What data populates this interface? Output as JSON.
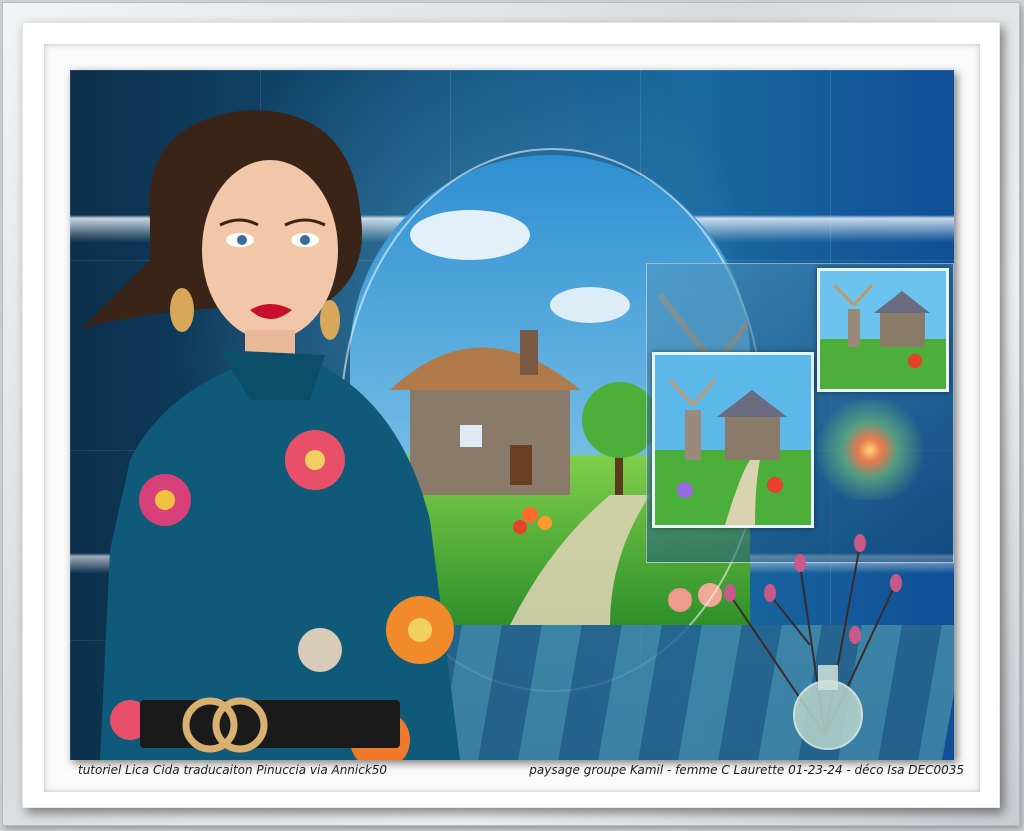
{
  "captions": {
    "left": "tutoriel Lica Cida traducaiton Pinuccia  via Annick50",
    "right": "paysage groupe Kamil - femme C Laurette 01-23-24 - déco Isa DEC0035"
  },
  "colors": {
    "background_blue": "#12507a",
    "teal_dress": "#0e5a78",
    "lipstick": "#c8102e",
    "grass": "#4caf3a",
    "sky": "#5cb8e8"
  },
  "icons": {
    "windmill": "windmill-icon",
    "cottage": "cottage-icon",
    "flower": "flower-icon",
    "vase": "vase-icon",
    "belt_buckle": "gg-buckle-icon"
  }
}
